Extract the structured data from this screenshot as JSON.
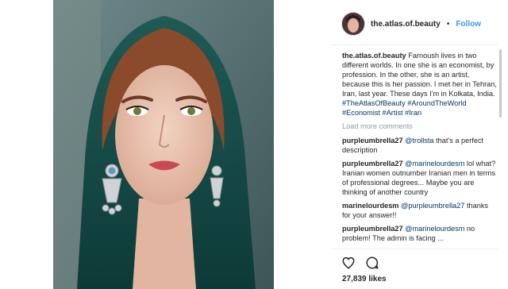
{
  "post": {
    "username": "the.atlas.of.beauty",
    "follow_label": "Follow",
    "separator": "•",
    "caption": {
      "user": "the.atlas.of.beauty",
      "text": "Farnoush lives in two different worlds. In one she is an economist, by profession. In the other, she is an artist, because this is her passion. I met her in Tehran, Iran, last year. These days I'm in Kolkata, India.",
      "hashtags": "#TheAtlasOfBeauty #AroundTheWorld #Economist #Artist #Iran"
    },
    "load_more_label": "Load more comments",
    "comments": [
      {
        "user": "purpleumbrella27",
        "mention": "@trollsta",
        "text": "that's a perfect description"
      },
      {
        "user": "purpleumbrella27",
        "mention": "@marinelourdesm",
        "text": "lol what? Iranian women outnumber Iranian men in terms of professional degrees... Maybe you are thinking of another country"
      },
      {
        "user": "marinelourdesm",
        "mention": "@purpleumbrella27",
        "text": "thanks for your answer!!"
      },
      {
        "user": "purpleumbrella27",
        "mention": "@marinelourdesm",
        "text": "no problem! The admin is facing ... "
      }
    ],
    "likes": "27,839 likes",
    "icons": {
      "like": "heart-icon",
      "comment": "comment-icon"
    }
  }
}
